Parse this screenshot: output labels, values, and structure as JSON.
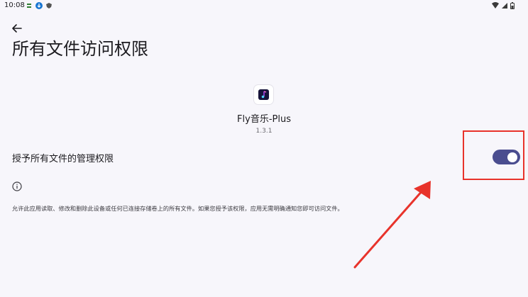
{
  "status_bar": {
    "time": "10:08"
  },
  "header": {
    "title": "所有文件访问权限"
  },
  "app": {
    "name": "Fly音乐-Plus",
    "version": "1.3.1"
  },
  "setting": {
    "label": "授予所有文件的管理权限",
    "enabled": true
  },
  "info": {
    "description": "允许此应用读取、修改和删除此设备或任何已连接存储卷上的所有文件。如果您授予该权限，应用无需明确通知您即可访问文件。"
  },
  "colors": {
    "background": "#f7f6fb",
    "toggle_track": "#4a4d8f",
    "annotation": "#e8332b"
  },
  "icons": {
    "back": "arrow-left-icon",
    "info": "info-icon",
    "wifi": "wifi-icon",
    "battery": "battery-icon"
  }
}
